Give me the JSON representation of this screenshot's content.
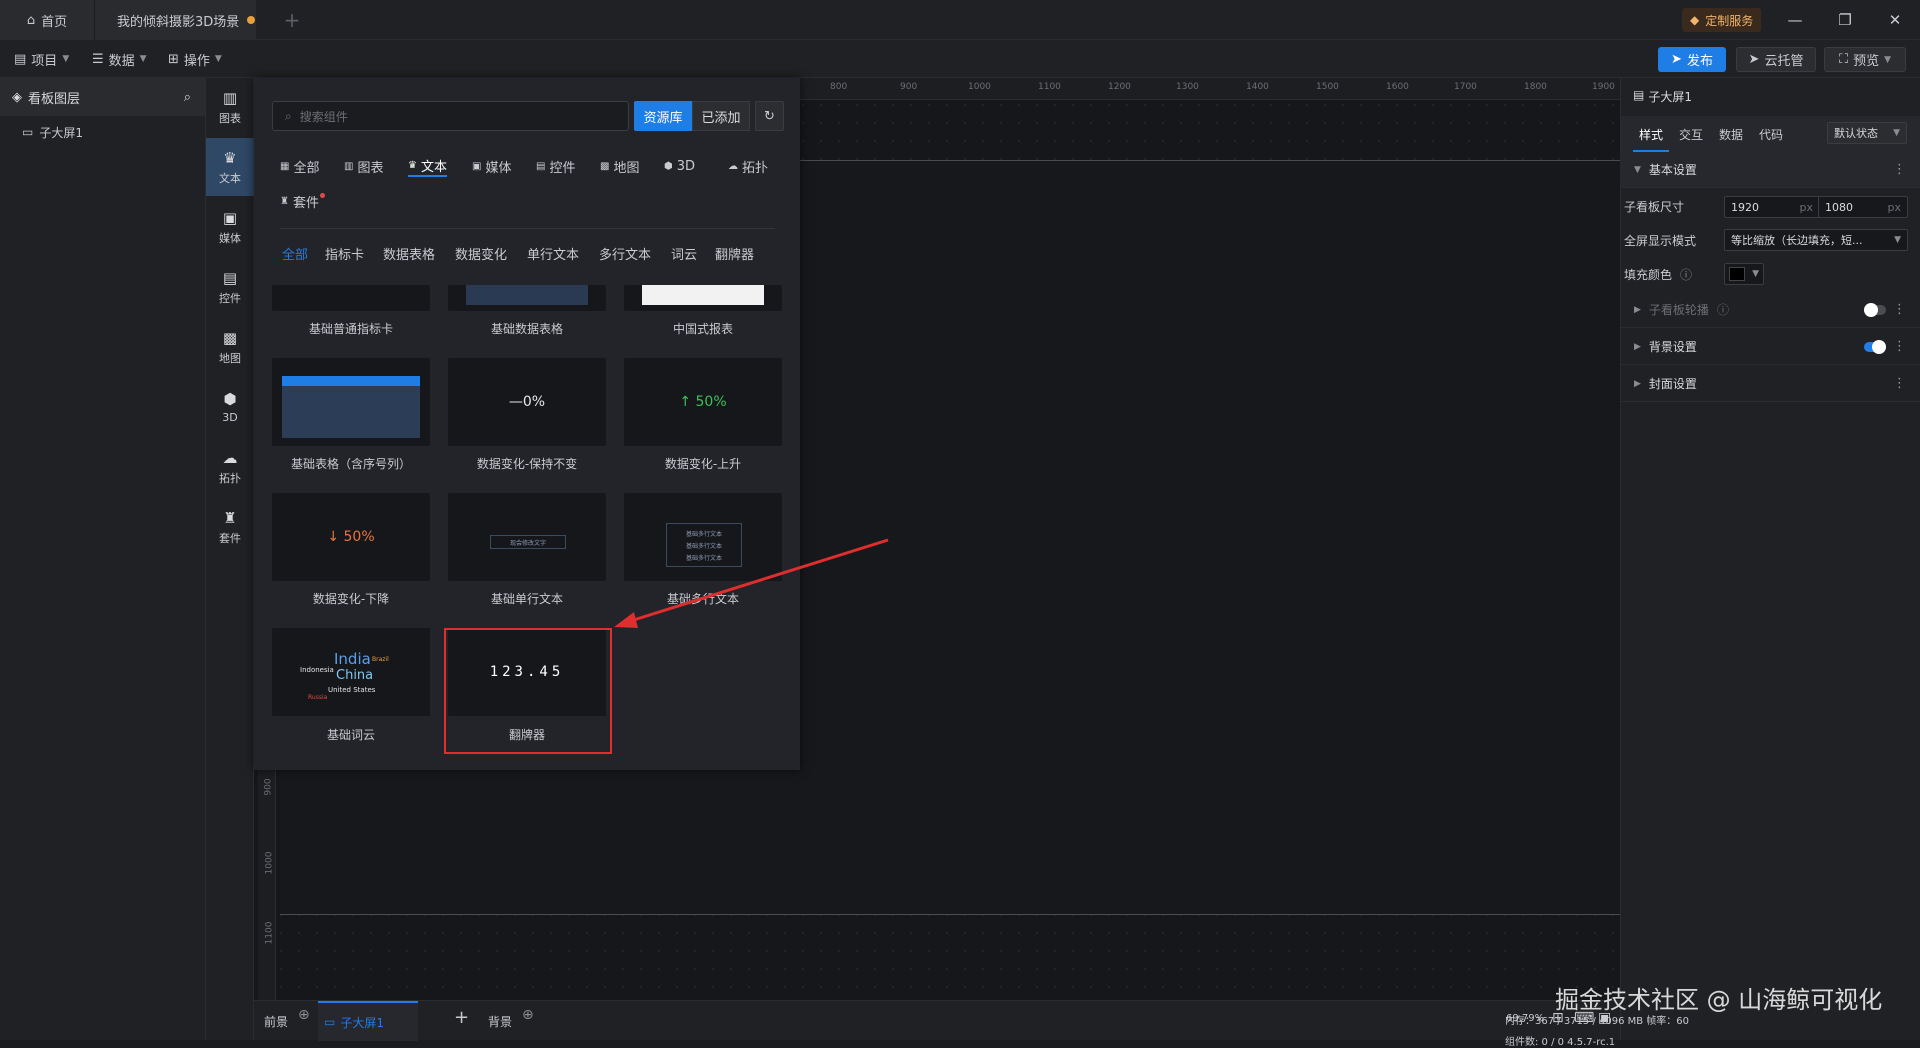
{
  "tabs": {
    "home": "首页",
    "project": "我的倾斜摄影3D场景",
    "add": "+"
  },
  "header": {
    "custom_service": "定制服务"
  },
  "menu": {
    "project": "项目",
    "data": "数据",
    "operate": "操作"
  },
  "toolbar": {
    "publish": "发布",
    "cloud": "云托管",
    "preview": "预览"
  },
  "layers": {
    "title": "看板图层",
    "item": "子大屏1"
  },
  "categories": [
    {
      "label": "图表",
      "icon": "chart-icon"
    },
    {
      "label": "文本",
      "icon": "text-icon"
    },
    {
      "label": "媒体",
      "icon": "media-icon"
    },
    {
      "label": "控件",
      "icon": "control-icon"
    },
    {
      "label": "地图",
      "icon": "map-icon"
    },
    {
      "label": "3D",
      "icon": "cube-icon"
    },
    {
      "label": "拓扑",
      "icon": "topology-icon"
    },
    {
      "label": "套件",
      "icon": "kit-icon"
    }
  ],
  "panel": {
    "search_placeholder": "搜索组件",
    "btn_library": "资源库",
    "btn_added": "已添加",
    "tabs": [
      "全部",
      "图表",
      "文本",
      "媒体",
      "控件",
      "地图",
      "3D",
      "拓扑",
      "套件"
    ],
    "subtabs": [
      "全部",
      "指标卡",
      "数据表格",
      "数据变化",
      "单行文本",
      "多行文本",
      "词云",
      "翻牌器"
    ],
    "cards": [
      {
        "label": "基础普通指标卡"
      },
      {
        "label": "基础数据表格"
      },
      {
        "label": "中国式报表"
      },
      {
        "label": "基础表格（含序号列）"
      },
      {
        "label": "数据变化-保持不变",
        "preview": "—0%"
      },
      {
        "label": "数据变化-上升",
        "preview": "↑ 50%"
      },
      {
        "label": "数据变化-下降",
        "preview": "↓ 50%"
      },
      {
        "label": "基础单行文本",
        "preview": "现会修改文字"
      },
      {
        "label": "基础多行文本",
        "preview_lines": [
          "基础多行文本",
          "基础多行文本",
          "基础多行文本"
        ]
      },
      {
        "label": "基础词云",
        "words": [
          "India",
          "China",
          "Indonesia",
          "United States",
          "Brazil",
          "Russia"
        ]
      },
      {
        "label": "翻牌器",
        "preview": "123.45"
      }
    ]
  },
  "ruler_top": [
    "800",
    "900",
    "1000",
    "1100",
    "1200",
    "1300",
    "1400",
    "1500",
    "1600",
    "1700",
    "1800",
    "1900"
  ],
  "ruler_left": [
    "900",
    "1000",
    "1100"
  ],
  "bottom": {
    "foreground": "前景",
    "screen_tab": "子大屏1",
    "add": "+",
    "background": "背景",
    "zoom": "69.79%"
  },
  "props": {
    "title": "子大屏1",
    "tabs": [
      "样式",
      "交互",
      "数据",
      "代码"
    ],
    "state": "默认状态",
    "basic": "基本设置",
    "size_label": "子看板尺寸",
    "width": "1920",
    "height": "1080",
    "unit": "px",
    "fullscreen_label": "全屏显示模式",
    "fullscreen_value": "等比缩放（长边填充，短...",
    "fill_label": "填充颜色",
    "fill_color": "#000000",
    "carousel": "子看板轮播",
    "bg": "背景设置",
    "cover": "封面设置"
  },
  "status": {
    "line1": "内存：367 / 3715 / 4096 MB    帧率：60",
    "line2": "组件数: 0 / 0    4.5.7-rc.1"
  },
  "watermark": "掘金技术社区 @ 山海鲸可视化",
  "colors": {
    "accent": "#1f7ee6",
    "highlight": "#e02d2d",
    "up": "#3fbf5a",
    "down": "#e8743b"
  }
}
